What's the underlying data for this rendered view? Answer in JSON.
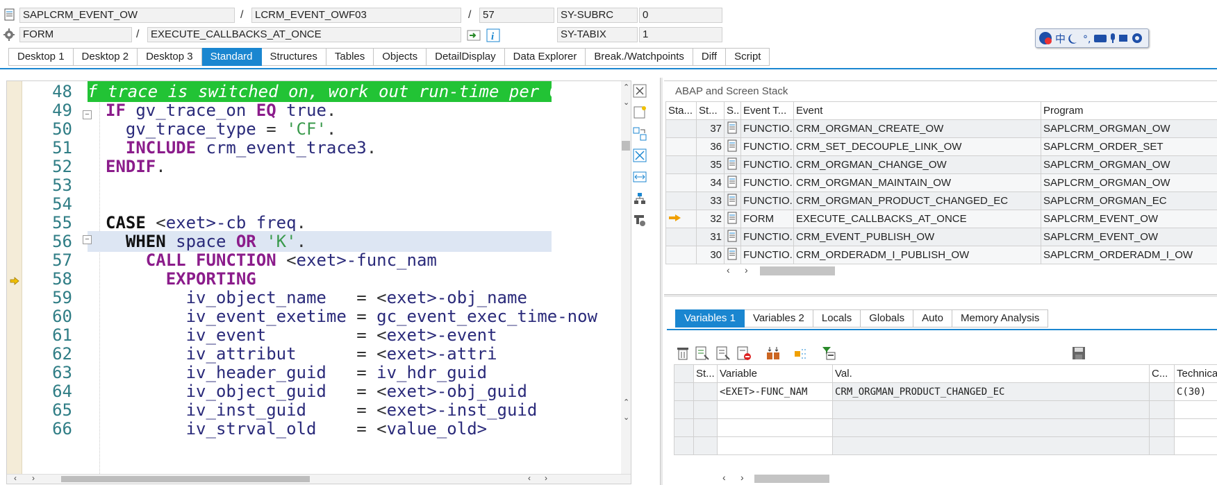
{
  "header": {
    "program": "SAPLCRM_EVENT_OW",
    "include": "LCRM_EVENT_OWF03",
    "line": "57",
    "subrc_label": "SY-SUBRC",
    "subrc_value": "0",
    "event_type": "FORM",
    "event_name": "EXECUTE_CALLBACKS_AT_ONCE",
    "tabix_label": "SY-TABIX",
    "tabix_value": "1",
    "slash": "/"
  },
  "tabs": [
    "Desktop 1",
    "Desktop 2",
    "Desktop 3",
    "Standard",
    "Structures",
    "Tables",
    "Objects",
    "DetailDisplay",
    "Data Explorer",
    "Break./Watchpoints",
    "Diff",
    "Script"
  ],
  "active_tab": "Standard",
  "editor": {
    "lines": [
      {
        "num": "48",
        "code": "f trace is switched on, work out run-time per Call"
      },
      {
        "num": "49",
        "code": "IF gv_trace_on EQ true."
      },
      {
        "num": "50",
        "code": "  gv_trace_type = 'CF'."
      },
      {
        "num": "51",
        "code": "  INCLUDE crm_event_trace3."
      },
      {
        "num": "52",
        "code": "ENDIF."
      },
      {
        "num": "53",
        "code": ""
      },
      {
        "num": "54",
        "code": ""
      },
      {
        "num": "55",
        "code": "CASE <exet>-cb_freq."
      },
      {
        "num": "56",
        "code": "  WHEN space OR 'K'."
      },
      {
        "num": "57",
        "code": "    CALL FUNCTION <exet>-func_nam"
      },
      {
        "num": "58",
        "code": "      EXPORTING"
      },
      {
        "num": "59",
        "code": "        iv_object_name   = <exet>-obj_name"
      },
      {
        "num": "60",
        "code": "        iv_event_exetime = gc_event_exec_time-now"
      },
      {
        "num": "61",
        "code": "        iv_event         = <exet>-event"
      },
      {
        "num": "62",
        "code": "        iv_attribut      = <exet>-attri"
      },
      {
        "num": "63",
        "code": "        iv_header_guid   = iv_hdr_guid"
      },
      {
        "num": "64",
        "code": "        iv_object_guid   = <exet>-obj_guid"
      },
      {
        "num": "65",
        "code": "        iv_inst_guid     = <exet>-inst_guid"
      },
      {
        "num": "66",
        "code": "        iv_strval_old    = <value_old>"
      }
    ]
  },
  "stack": {
    "title": "ABAP and Screen Stack",
    "columns": [
      "Sta...",
      "St...",
      "S..",
      "Event T...",
      "Event",
      "Program"
    ],
    "rows": [
      {
        "st": "37",
        "etype": "FUNCTIO...",
        "event": "CRM_ORGMAN_CREATE_OW",
        "program": "SAPLCRM_ORGMAN_OW",
        "current": false
      },
      {
        "st": "36",
        "etype": "FUNCTIO...",
        "event": "CRM_SET_DECOUPLE_LINK_OW",
        "program": "SAPLCRM_ORDER_SET",
        "current": false
      },
      {
        "st": "35",
        "etype": "FUNCTIO...",
        "event": "CRM_ORGMAN_CHANGE_OW",
        "program": "SAPLCRM_ORGMAN_OW",
        "current": false
      },
      {
        "st": "34",
        "etype": "FUNCTIO...",
        "event": "CRM_ORGMAN_MAINTAIN_OW",
        "program": "SAPLCRM_ORGMAN_OW",
        "current": false
      },
      {
        "st": "33",
        "etype": "FUNCTIO...",
        "event": "CRM_ORGMAN_PRODUCT_CHANGED_EC",
        "program": "SAPLCRM_ORGMAN_EC",
        "current": false
      },
      {
        "st": "32",
        "etype": "FORM",
        "event": "EXECUTE_CALLBACKS_AT_ONCE",
        "program": "SAPLCRM_EVENT_OW",
        "current": true
      },
      {
        "st": "31",
        "etype": "FUNCTIO...",
        "event": "CRM_EVENT_PUBLISH_OW",
        "program": "SAPLCRM_EVENT_OW",
        "current": false
      },
      {
        "st": "30",
        "etype": "FUNCTIO...",
        "event": "CRM_ORDERADM_I_PUBLISH_OW",
        "program": "SAPLCRM_ORDERADM_I_OW",
        "current": false
      }
    ]
  },
  "variables": {
    "tabs": [
      "Variables 1",
      "Variables 2",
      "Locals",
      "Globals",
      "Auto",
      "Memory Analysis"
    ],
    "active_tab": "Variables 1",
    "columns": [
      "St...",
      "Variable",
      "Val.",
      "C...",
      "Technica"
    ],
    "rows": [
      {
        "variable": "<EXET>-FUNC_NAM",
        "value": "CRM_ORGMAN_PRODUCT_CHANGED_EC",
        "tech": "C(30)"
      }
    ]
  },
  "colors": {
    "accent": "#1a86d0",
    "comment_bg": "#22c335",
    "keyword": "#8b1c8b",
    "current_arrow": "#f0a000"
  }
}
